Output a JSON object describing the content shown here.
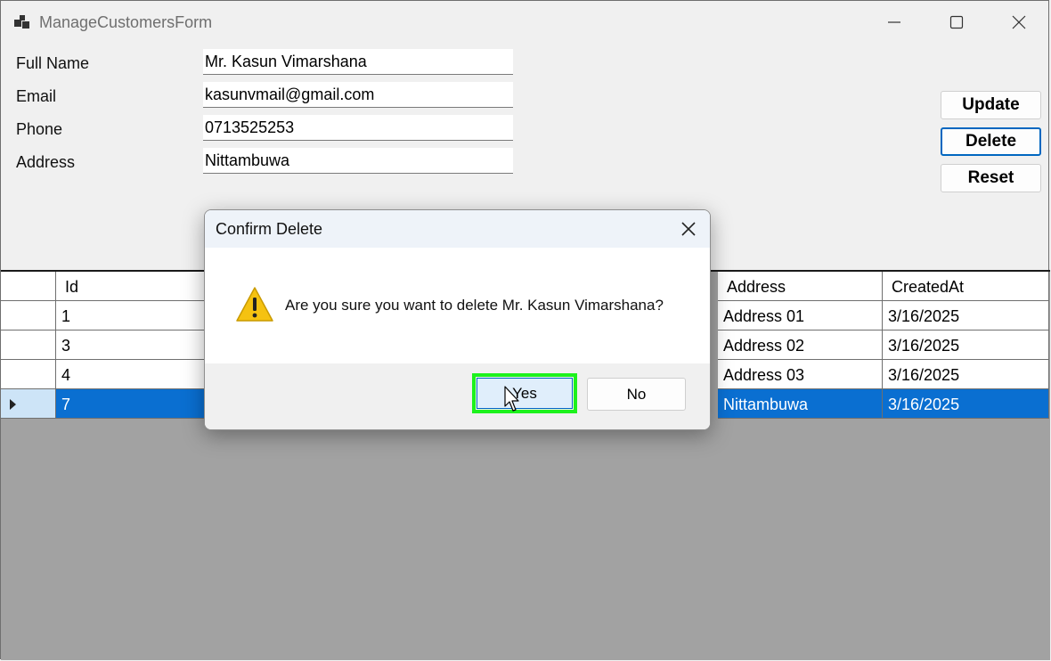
{
  "window": {
    "title": "ManageCustomersForm"
  },
  "form": {
    "fields": [
      {
        "label": "Full Name",
        "value": "Mr. Kasun Vimarshana"
      },
      {
        "label": "Email",
        "value": "kasunvmail@gmail.com"
      },
      {
        "label": "Phone",
        "value": "0713525253"
      },
      {
        "label": "Address",
        "value": "Nittambuwa"
      }
    ]
  },
  "buttons": {
    "update": "Update",
    "delete": "Delete",
    "reset": "Reset"
  },
  "grid": {
    "columns": [
      "",
      "Id",
      "Address",
      "CreatedAt"
    ],
    "rows": [
      {
        "id": "1",
        "address": "Address 01",
        "created": "3/16/2025",
        "selected": false
      },
      {
        "id": "3",
        "address": "Address 02",
        "created": "3/16/2025",
        "selected": false
      },
      {
        "id": "4",
        "address": "Address 03",
        "created": "3/16/2025",
        "selected": false
      },
      {
        "id": "7",
        "address": "Nittambuwa",
        "created": "3/16/2025",
        "selected": true
      }
    ]
  },
  "dialog": {
    "title": "Confirm Delete",
    "message": "Are you sure you want to delete Mr. Kasun Vimarshana?",
    "yes_label": "Yes",
    "no_label": "No",
    "icon": "warning-icon"
  },
  "colors": {
    "selection": "#0a6fd1",
    "highlight": "#1df21d",
    "warning": "#f5c211"
  }
}
